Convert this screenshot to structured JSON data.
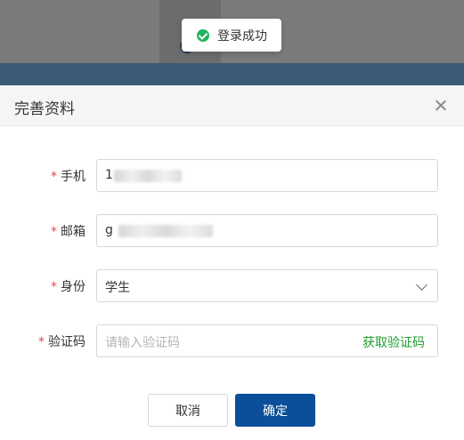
{
  "toast": {
    "message": "登录成功",
    "icon": "check-circle-icon",
    "color": "#21b35e"
  },
  "dialog": {
    "title": "完善资料",
    "close_icon": "close-icon",
    "fields": {
      "phone": {
        "label": "手机",
        "value": "1"
      },
      "email": {
        "label": "邮箱",
        "value": "g"
      },
      "identity": {
        "label": "身份",
        "value": "学生"
      },
      "code": {
        "label": "验证码",
        "placeholder": "请输入验证码",
        "action": "获取验证码"
      }
    },
    "buttons": {
      "cancel": "取消",
      "confirm": "确定"
    },
    "colors": {
      "accent": "#0b4e99",
      "link": "#1f9e2f",
      "required": "#e2474e"
    }
  }
}
